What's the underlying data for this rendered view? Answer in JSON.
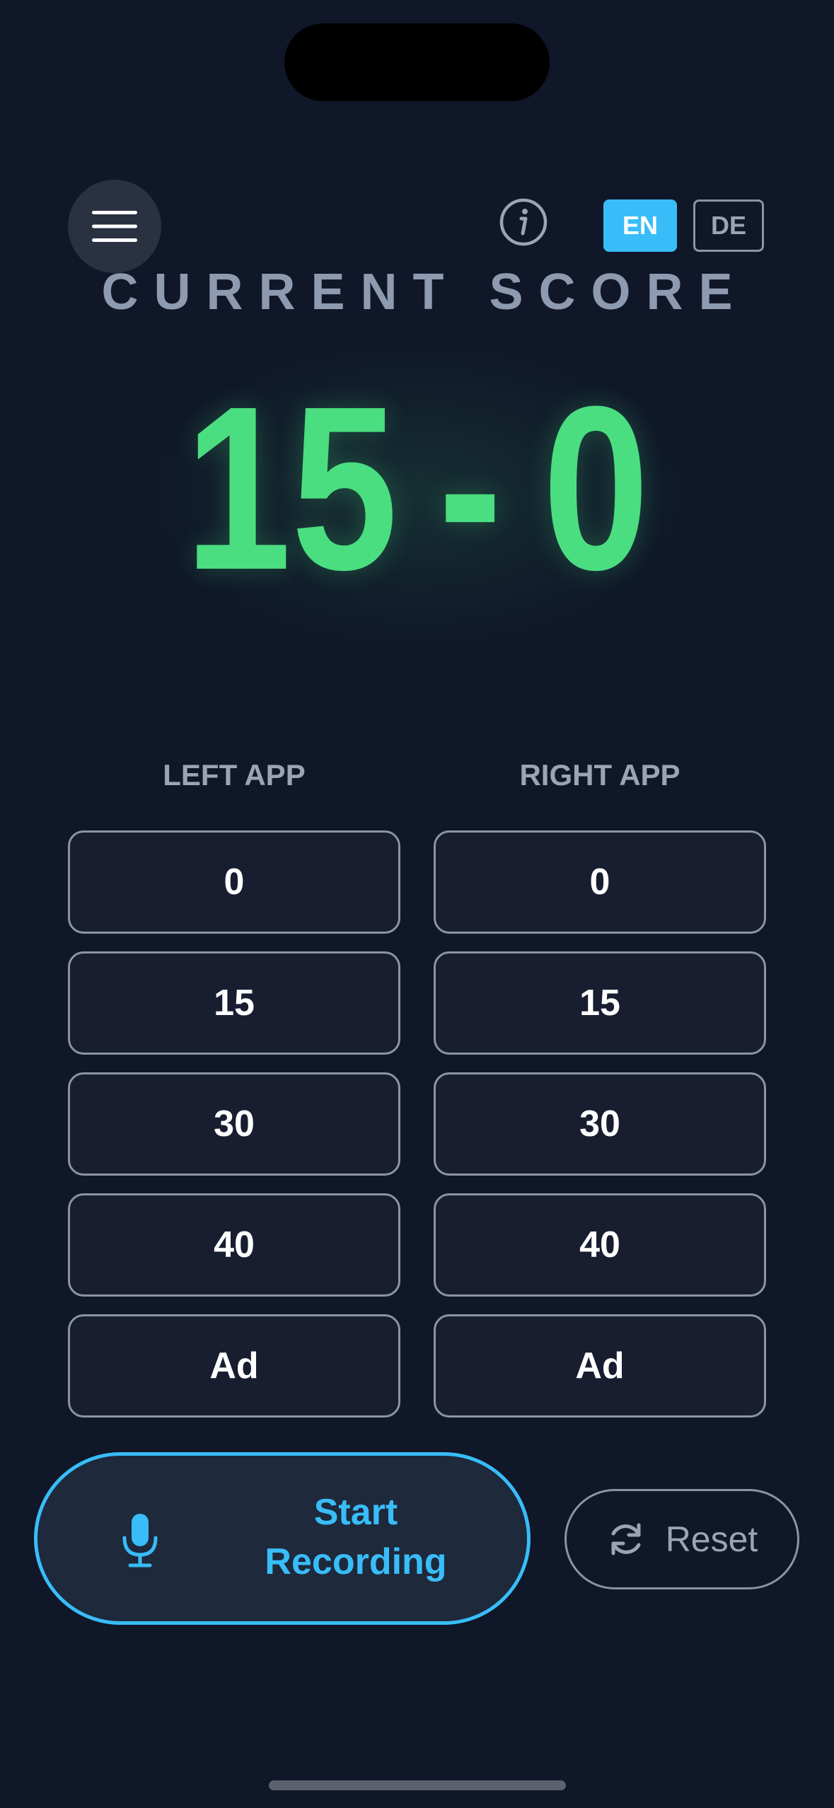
{
  "header": {
    "menu_icon": "hamburger-menu-icon",
    "info_icon": "info-icon",
    "languages": [
      {
        "label": "EN",
        "active": true
      },
      {
        "label": "DE",
        "active": false
      }
    ]
  },
  "score": {
    "title": "CURRENT SCORE",
    "left": "15",
    "separator": "-",
    "right": "0",
    "color": "#4ade80"
  },
  "columns": {
    "left": {
      "title": "LEFT APP",
      "points": [
        "0",
        "15",
        "30",
        "40",
        "Ad"
      ]
    },
    "right": {
      "title": "RIGHT APP",
      "points": [
        "0",
        "15",
        "30",
        "40",
        "Ad"
      ]
    }
  },
  "actions": {
    "record_line1": "Start",
    "record_line2": "Recording",
    "record_icon": "microphone-icon",
    "reset_label": "Reset",
    "reset_icon": "refresh-icon"
  },
  "colors": {
    "background": "#0f1728",
    "accent": "#38bdf8",
    "score": "#4ade80",
    "muted": "#9aa4b5"
  }
}
